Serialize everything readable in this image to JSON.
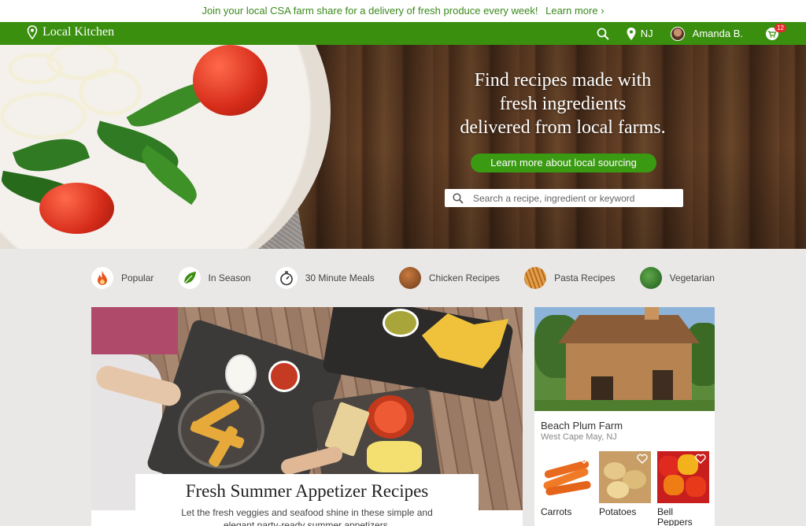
{
  "announcement": {
    "text": "Join your local CSA farm share for a delivery of fresh produce every week!",
    "link": "Learn more ›"
  },
  "nav": {
    "brand": "Local Kitchen",
    "location": "NJ",
    "user": "Amanda B.",
    "cart_count": "12"
  },
  "hero": {
    "headline_lines": [
      "Find recipes made with",
      "fresh ingredients",
      "delivered from local farms."
    ],
    "cta": "Learn more about local sourcing",
    "search_placeholder": "Search a recipe, ingredient or keyword"
  },
  "categories": [
    {
      "label": "Popular",
      "icon": "flame-icon",
      "color": "#e8541e"
    },
    {
      "label": "In Season",
      "icon": "leaf-icon",
      "color": "#3a8f0f"
    },
    {
      "label": "30 Minute Meals",
      "icon": "stopwatch-icon",
      "color": "#333333"
    },
    {
      "label": "Chicken Recipes",
      "icon": "chicken-icon",
      "color": "#8a4a24"
    },
    {
      "label": "Pasta Recipes",
      "icon": "pasta-icon",
      "color": "#c7752a"
    },
    {
      "label": "Vegetarian",
      "icon": "greens-icon",
      "color": "#2f6f2a"
    }
  ],
  "featured": {
    "title": "Fresh Summer Appetizer Recipes",
    "description_lines": [
      "Let the fresh veggies and seafood shine in these simple and",
      "elegant party-ready summer appetizers."
    ]
  },
  "farm": {
    "name": "Beach Plum Farm",
    "location": "West Cape May, NJ",
    "produce": [
      {
        "label_lines": [
          "Carrots"
        ]
      },
      {
        "label_lines": [
          "Potatoes"
        ]
      },
      {
        "label_lines": [
          "Bell",
          "Peppers"
        ]
      }
    ]
  },
  "colors": {
    "brand_green": "#3a8f0f",
    "button_green": "#3a9a12",
    "badge_red": "#e52a2a"
  }
}
